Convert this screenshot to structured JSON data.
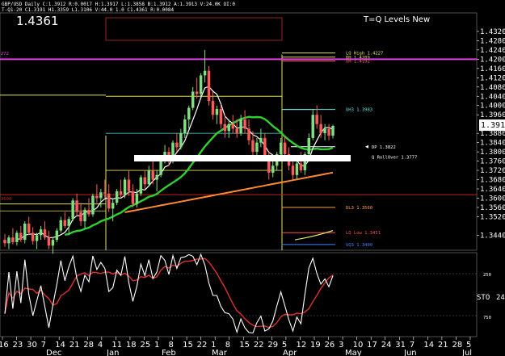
{
  "header": {
    "line1": "GBP/USD Daily  C:1.3912  R:0.0017  H:1.3917  L:1.3858  B:1.3912  A:1.3913  V:24.0K  OI:0",
    "line2": "T-Q1-20  C1.3191  H1.3359  L1.3106  V:44.0  1.0  C1.4361  R:0.0084"
  },
  "big_value": "1.4361",
  "indicator_title": "T=Q Levels New",
  "current_price": "1.3912",
  "left_markers": {
    "pink": "272",
    "red": "3600"
  },
  "stoch_label": "STO",
  "stoch_value": "24",
  "stoch_axis": [
    "250",
    "750"
  ],
  "colors": {
    "background": "#000000",
    "bull": "#7fe07f",
    "bear": "#ff5a5a",
    "ma_fast": "#ffffff",
    "ma_mid": "#30d030",
    "ma_slow": "#ff8a30",
    "stoch_k": "#ffffff",
    "stoch_d": "#e03030",
    "magenta": "#e040e0",
    "yellow": "#e0e060",
    "cyan": "#60e0e0",
    "red_level": "#c02020"
  },
  "chart_data": {
    "type": "candlestick",
    "symbol": "GBP/USD",
    "timeframe": "Daily",
    "ylim": [
      1.3375,
      1.44
    ],
    "yticks": [
      1.344,
      1.352,
      1.356,
      1.36,
      1.364,
      1.368,
      1.372,
      1.376,
      1.38,
      1.384,
      1.388,
      1.396,
      1.4,
      1.404,
      1.408,
      1.412,
      1.416,
      1.42,
      1.424,
      1.428,
      1.432
    ],
    "xticks": [
      "16",
      "23",
      "30",
      "7",
      "14",
      "21",
      "28",
      "4",
      "11",
      "18",
      "25",
      "1",
      "8",
      "15",
      "22",
      "1",
      "8",
      "15",
      "22",
      "29",
      "5",
      "12",
      "19",
      "26",
      "3",
      "10",
      "17",
      "24",
      "31",
      "7",
      "14",
      "21",
      "28",
      "5"
    ],
    "months": [
      "Dec",
      "Jan",
      "Feb",
      "Mar",
      "Apr",
      "May",
      "Jun",
      "Jul"
    ],
    "candles": [
      [
        1.342,
        1.3445,
        1.339,
        1.3405
      ],
      [
        1.3405,
        1.344,
        1.338,
        1.343
      ],
      [
        1.343,
        1.347,
        1.34,
        1.341
      ],
      [
        1.341,
        1.346,
        1.3395,
        1.345
      ],
      [
        1.345,
        1.348,
        1.341,
        1.342
      ],
      [
        1.342,
        1.35,
        1.3405,
        1.349
      ],
      [
        1.349,
        1.352,
        1.344,
        1.345
      ],
      [
        1.345,
        1.3475,
        1.34,
        1.3415
      ],
      [
        1.3415,
        1.345,
        1.338,
        1.344
      ],
      [
        1.344,
        1.348,
        1.342,
        1.3465
      ],
      [
        1.3465,
        1.35,
        1.342,
        1.343
      ],
      [
        1.343,
        1.346,
        1.338,
        1.3395
      ],
      [
        1.3395,
        1.343,
        1.336,
        1.342
      ],
      [
        1.342,
        1.347,
        1.341,
        1.346
      ],
      [
        1.346,
        1.352,
        1.345,
        1.3505
      ],
      [
        1.3505,
        1.354,
        1.347,
        1.348
      ],
      [
        1.348,
        1.352,
        1.344,
        1.351
      ],
      [
        1.351,
        1.36,
        1.35,
        1.359
      ],
      [
        1.359,
        1.362,
        1.352,
        1.354
      ],
      [
        1.354,
        1.358,
        1.348,
        1.35
      ],
      [
        1.35,
        1.356,
        1.347,
        1.355
      ],
      [
        1.355,
        1.36,
        1.352,
        1.353
      ],
      [
        1.353,
        1.362,
        1.352,
        1.361
      ],
      [
        1.361,
        1.366,
        1.358,
        1.36
      ],
      [
        1.36,
        1.364,
        1.356,
        1.3625
      ],
      [
        1.3625,
        1.368,
        1.36,
        1.362
      ],
      [
        1.362,
        1.366,
        1.354,
        1.3555
      ],
      [
        1.3555,
        1.36,
        1.35,
        1.358
      ],
      [
        1.358,
        1.364,
        1.357,
        1.363
      ],
      [
        1.363,
        1.368,
        1.36,
        1.3615
      ],
      [
        1.3615,
        1.369,
        1.36,
        1.368
      ],
      [
        1.368,
        1.372,
        1.361,
        1.363
      ],
      [
        1.363,
        1.366,
        1.356,
        1.3575
      ],
      [
        1.3575,
        1.364,
        1.356,
        1.362
      ],
      [
        1.362,
        1.37,
        1.361,
        1.369
      ],
      [
        1.369,
        1.372,
        1.364,
        1.366
      ],
      [
        1.366,
        1.374,
        1.365,
        1.372
      ],
      [
        1.372,
        1.376,
        1.366,
        1.368
      ],
      [
        1.368,
        1.372,
        1.363,
        1.37
      ],
      [
        1.37,
        1.378,
        1.369,
        1.377
      ],
      [
        1.377,
        1.383,
        1.375,
        1.38
      ],
      [
        1.38,
        1.382,
        1.374,
        1.376
      ],
      [
        1.376,
        1.385,
        1.375,
        1.384
      ],
      [
        1.384,
        1.388,
        1.38,
        1.382
      ],
      [
        1.382,
        1.39,
        1.381,
        1.388
      ],
      [
        1.388,
        1.396,
        1.386,
        1.394
      ],
      [
        1.394,
        1.4,
        1.39,
        1.399
      ],
      [
        1.399,
        1.408,
        1.398,
        1.406
      ],
      [
        1.406,
        1.412,
        1.403,
        1.405
      ],
      [
        1.405,
        1.414,
        1.404,
        1.413
      ],
      [
        1.413,
        1.424,
        1.41,
        1.415
      ],
      [
        1.415,
        1.417,
        1.4,
        1.402
      ],
      [
        1.402,
        1.406,
        1.394,
        1.396
      ],
      [
        1.396,
        1.4,
        1.392,
        1.3985
      ],
      [
        1.3985,
        1.4,
        1.39,
        1.392
      ],
      [
        1.392,
        1.396,
        1.386,
        1.389
      ],
      [
        1.389,
        1.394,
        1.386,
        1.392
      ],
      [
        1.392,
        1.396,
        1.388,
        1.39
      ],
      [
        1.39,
        1.394,
        1.386,
        1.388
      ],
      [
        1.388,
        1.396,
        1.387,
        1.394
      ],
      [
        1.394,
        1.398,
        1.388,
        1.39
      ],
      [
        1.39,
        1.394,
        1.383,
        1.385
      ],
      [
        1.385,
        1.389,
        1.378,
        1.38
      ],
      [
        1.38,
        1.386,
        1.376,
        1.384
      ],
      [
        1.384,
        1.39,
        1.382,
        1.386
      ],
      [
        1.386,
        1.388,
        1.376,
        1.378
      ],
      [
        1.378,
        1.38,
        1.368,
        1.371
      ],
      [
        1.371,
        1.376,
        1.369,
        1.374
      ],
      [
        1.374,
        1.38,
        1.372,
        1.379
      ],
      [
        1.379,
        1.386,
        1.377,
        1.384
      ],
      [
        1.384,
        1.387,
        1.378,
        1.379
      ],
      [
        1.379,
        1.382,
        1.372,
        1.374
      ],
      [
        1.374,
        1.376,
        1.368,
        1.37
      ],
      [
        1.37,
        1.376,
        1.368,
        1.375
      ],
      [
        1.375,
        1.38,
        1.371,
        1.372
      ],
      [
        1.372,
        1.38,
        1.37,
        1.379
      ],
      [
        1.379,
        1.388,
        1.378,
        1.386
      ],
      [
        1.386,
        1.398,
        1.385,
        1.396
      ],
      [
        1.396,
        1.4,
        1.39,
        1.392
      ],
      [
        1.392,
        1.396,
        1.386,
        1.388
      ],
      [
        1.388,
        1.392,
        1.385,
        1.39
      ],
      [
        1.39,
        1.392,
        1.385,
        1.387
      ],
      [
        1.387,
        1.3917,
        1.3858,
        1.3912
      ]
    ],
    "levels": [
      {
        "name": "LQ High",
        "label": "LQ High 1.4227",
        "value": 1.4227,
        "color": "#e0e060"
      },
      {
        "name": "DH",
        "label": "DH 1.4209",
        "value": 1.4209,
        "color": "#e0e060"
      },
      {
        "name": "pink",
        "label": "",
        "value": 1.42,
        "color": "#e040e0"
      },
      {
        "name": "UH",
        "label": "UH 1.4192",
        "value": 1.4192,
        "color": "#ff6060"
      },
      {
        "name": "UH3",
        "label": "UH3 1.3983",
        "value": 1.3983,
        "color": "#60e0e0"
      },
      {
        "name": "DP",
        "label": "DP 1.3822",
        "value": 1.3822,
        "color": "#ffffff"
      },
      {
        "name": "Q Rollover",
        "label": "Q RollOver 1.3777",
        "value": 1.3777,
        "color": "#ffffff"
      },
      {
        "name": "red",
        "label": "",
        "value": 1.3615,
        "color": "#c02020"
      },
      {
        "name": "DL3",
        "label": "DL3 1.3560",
        "value": 1.356,
        "color": "#ffa040"
      },
      {
        "name": "LQ Low",
        "label": "LQ Low 1.3451",
        "value": 1.3451,
        "color": "#ff5050"
      },
      {
        "name": "UQ3",
        "label": "UQ3 1.3400",
        "value": 1.34,
        "color": "#4080ff"
      }
    ]
  }
}
